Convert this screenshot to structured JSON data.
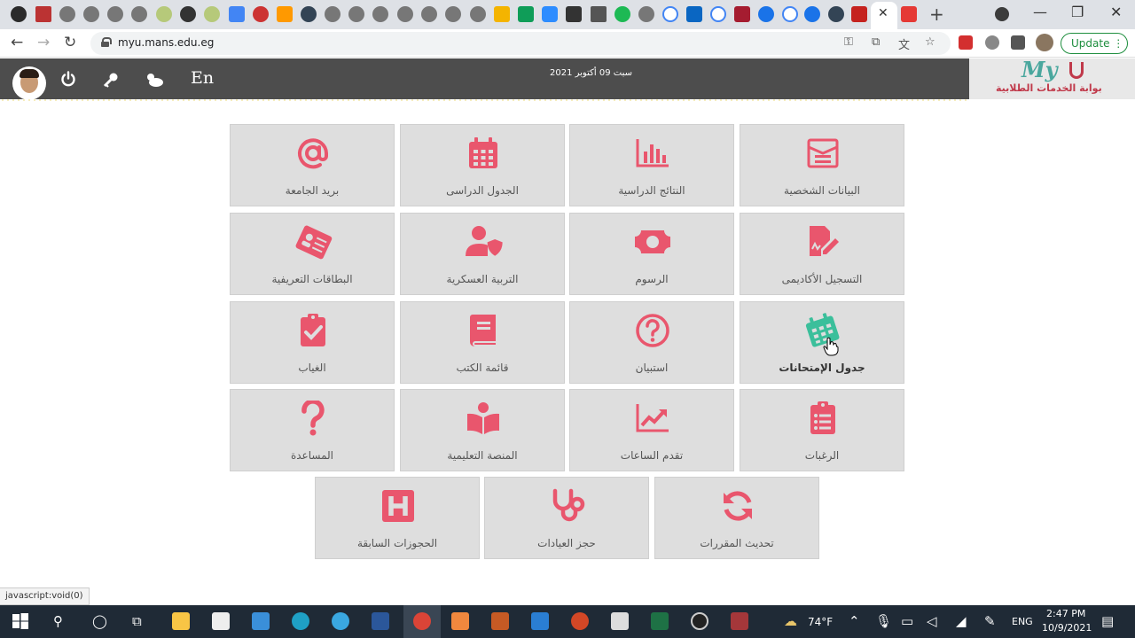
{
  "browser": {
    "url": "myu.mans.edu.eg",
    "update_label": "Update",
    "status_text": "javascript:void(0)"
  },
  "header": {
    "lang_label": "En",
    "date": "سبت 09 أكتوبر 2021",
    "logo_text": "My",
    "logo_subtitle": "بوابة الخدمات الطلابية"
  },
  "tiles": [
    {
      "label": "البيانات الشخصية",
      "icon": "id-card-icon"
    },
    {
      "label": "النتائج الدراسية",
      "icon": "bar-chart-icon"
    },
    {
      "label": "الجدول الدراسى",
      "icon": "calendar-icon"
    },
    {
      "label": "بريد الجامعة",
      "icon": "at-sign-icon"
    },
    {
      "label": "التسجيل الأكاديمى",
      "icon": "file-signature-icon"
    },
    {
      "label": "الرسوم",
      "icon": "money-bill-icon"
    },
    {
      "label": "التربية العسكرية",
      "icon": "user-shield-icon"
    },
    {
      "label": "البطاقات التعريفية",
      "icon": "id-badge-icon"
    },
    {
      "label": "جدول الإمتحانات",
      "icon": "exam-calendar-icon"
    },
    {
      "label": "استبيان",
      "icon": "question-circle-icon"
    },
    {
      "label": "قائمة الكتب",
      "icon": "book-icon"
    },
    {
      "label": "الغياب",
      "icon": "clipboard-check-icon"
    },
    {
      "label": "الرغبات",
      "icon": "clipboard-list-icon"
    },
    {
      "label": "تقدم الساعات",
      "icon": "chart-line-icon"
    },
    {
      "label": "المنصة التعليمية",
      "icon": "book-open-icon"
    },
    {
      "label": "المساعدة",
      "icon": "question-icon"
    },
    {
      "label": "تحديث المقررات",
      "icon": "sync-icon"
    },
    {
      "label": "حجز العيادات",
      "icon": "stethoscope-icon"
    },
    {
      "label": "الحجوزات السابقة",
      "icon": "hospital-icon"
    }
  ],
  "taskbar": {
    "weather": "74°F",
    "language": "ENG",
    "time": "2:47 PM",
    "date": "10/9/2021"
  },
  "colors": {
    "accent": "#e9566d",
    "active_icon": "#3bbf9b",
    "header_bg": "#4d4d4d",
    "tile_bg": "#dedede"
  }
}
